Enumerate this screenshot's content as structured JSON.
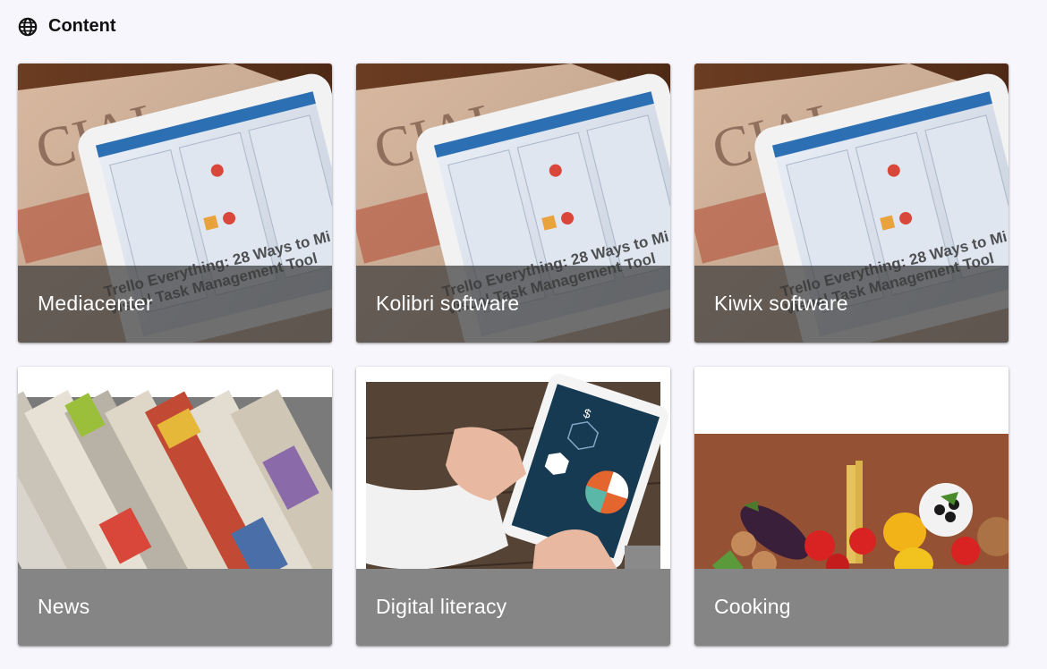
{
  "header": {
    "icon": "globe-icon",
    "title": "Content"
  },
  "cards": [
    {
      "label": "Mediacenter",
      "image": "tablet-newspaper-photo"
    },
    {
      "label": "Kolibri software",
      "image": "tablet-newspaper-photo"
    },
    {
      "label": "Kiwix software",
      "image": "tablet-newspaper-photo"
    },
    {
      "label": "News",
      "image": "newspapers-photo"
    },
    {
      "label": "Digital literacy",
      "image": "tablet-hands-photo"
    },
    {
      "label": "Cooking",
      "image": "vegetables-photo"
    }
  ],
  "tablet_art": {
    "headline_line1": "Trello Everything: 28 Ways to Mi",
    "headline_line2": "Visual Task Management Tool",
    "paper_word": "CIAL"
  }
}
